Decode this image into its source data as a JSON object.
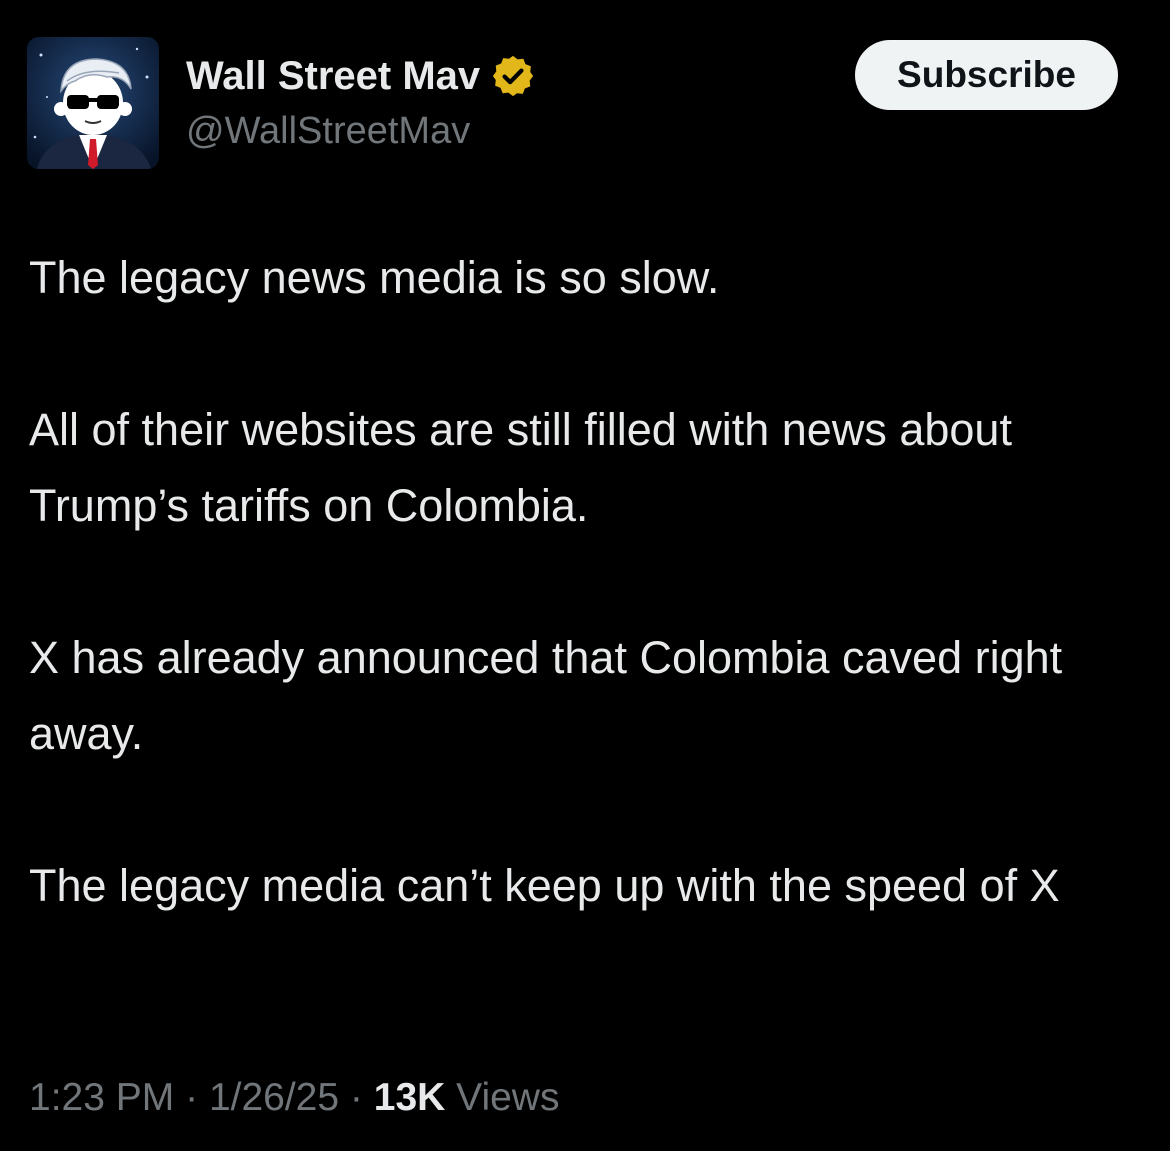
{
  "author": {
    "display_name": "Wall Street Mav",
    "handle": "@WallStreetMav",
    "verified_icon": "verified-badge-icon",
    "verified_color": "#e2b719"
  },
  "actions": {
    "subscribe_label": "Subscribe"
  },
  "tweet": {
    "paragraphs": [
      "The legacy news media is so slow.",
      "All of their websites are still filled with news about Trump’s tariffs on Colombia.",
      "X has already announced that Colombia caved right away.",
      "The legacy media can’t keep up with the speed of X"
    ]
  },
  "meta": {
    "time": "1:23 PM",
    "separator": "·",
    "date": "1/26/25",
    "views_count": "13K",
    "views_label": "Views"
  },
  "colors": {
    "background": "#000000",
    "text_primary": "#e7e9ea",
    "text_secondary": "#71767b",
    "subscribe_bg": "#eff3f4"
  }
}
